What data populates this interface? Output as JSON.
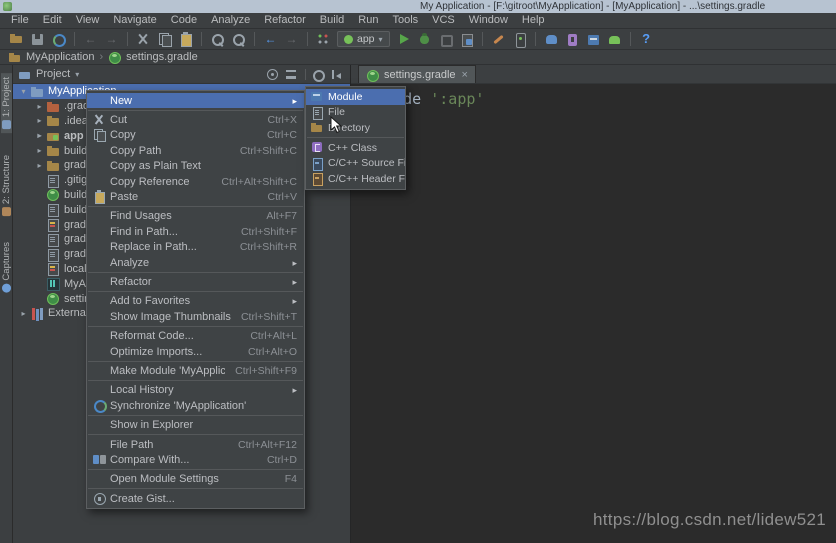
{
  "window": {
    "title": "My Application - [F:\\gitroot\\MyApplication] - [MyApplication] - ...\\settings.gradle"
  },
  "menu_bar": {
    "items": [
      "File",
      "Edit",
      "View",
      "Navigate",
      "Code",
      "Analyze",
      "Refactor",
      "Build",
      "Run",
      "Tools",
      "VCS",
      "Window",
      "Help"
    ]
  },
  "toolbar": {
    "app_selector_label": "app",
    "icons": [
      "open-icon",
      "save-icon",
      "sync-icon",
      "undo-icon",
      "redo-icon",
      "cut-icon",
      "copy-icon",
      "paste-icon",
      "find-icon",
      "search-everywhere-icon",
      "back-icon",
      "forward-icon",
      "run-config-icon",
      "app-selector",
      "run-icon",
      "debug-icon",
      "coverage-icon",
      "attach-debugger-icon",
      "sdk-manager-icon",
      "avd-manager-icon",
      "gradle-sync-icon",
      "device-explorer-icon",
      "build-icon",
      "android-icon",
      "help-icon"
    ]
  },
  "breadcrumb": {
    "project": "MyApplication",
    "file": "settings.gradle"
  },
  "left_stripe": {
    "items": [
      "1: Project",
      "2: Structure",
      "Captures"
    ]
  },
  "project_panel": {
    "header": "Project",
    "tree": [
      {
        "label": "MyApplication",
        "icon": "project-folder",
        "state": "expanded",
        "selected": true
      },
      {
        "label": ".gradle",
        "icon": "folder",
        "state": "collapsed"
      },
      {
        "label": ".idea",
        "icon": "folder",
        "state": "collapsed"
      },
      {
        "label": "app",
        "icon": "module-folder",
        "state": "collapsed"
      },
      {
        "label": "build",
        "icon": "folder",
        "state": "collapsed"
      },
      {
        "label": "gradle",
        "icon": "folder",
        "state": "collapsed"
      },
      {
        "label": ".gitignore",
        "icon": "file"
      },
      {
        "label": "build.gradle",
        "icon": "gradle-file"
      },
      {
        "label": "build.gradle",
        "icon": "file"
      },
      {
        "label": "gradle.properties",
        "icon": "properties-file"
      },
      {
        "label": "gradlew",
        "icon": "file"
      },
      {
        "label": "gradlew.bat",
        "icon": "file"
      },
      {
        "label": "local.properties",
        "icon": "properties-file"
      },
      {
        "label": "MyApplication.iml",
        "icon": "android-studio-file"
      },
      {
        "label": "settings.gradle",
        "icon": "gradle-file"
      },
      {
        "label": "External Libraries",
        "icon": "libraries",
        "state": "collapsed"
      }
    ]
  },
  "editor": {
    "tab_label": "settings.gradle",
    "code": {
      "method": "include ",
      "argument": "':app'"
    }
  },
  "context_menu": {
    "items": [
      {
        "label": "New",
        "submenu": true,
        "highlighted": true
      },
      {
        "label": "Cut",
        "shortcut": "Ctrl+X",
        "icon": "cut-icon"
      },
      {
        "label": "Copy",
        "shortcut": "Ctrl+C",
        "icon": "copy-icon"
      },
      {
        "label": "Copy Path",
        "shortcut": "Ctrl+Shift+C"
      },
      {
        "label": "Copy as Plain Text"
      },
      {
        "label": "Copy Reference",
        "shortcut": "Ctrl+Alt+Shift+C"
      },
      {
        "label": "Paste",
        "shortcut": "Ctrl+V",
        "icon": "paste-icon"
      },
      {
        "label": "Find Usages",
        "shortcut": "Alt+F7"
      },
      {
        "label": "Find in Path...",
        "shortcut": "Ctrl+Shift+F"
      },
      {
        "label": "Replace in Path...",
        "shortcut": "Ctrl+Shift+R"
      },
      {
        "label": "Analyze",
        "submenu": true
      },
      {
        "label": "Refactor",
        "submenu": true
      },
      {
        "label": "Add to Favorites",
        "submenu": true
      },
      {
        "label": "Show Image Thumbnails",
        "shortcut": "Ctrl+Shift+T"
      },
      {
        "label": "Reformat Code...",
        "shortcut": "Ctrl+Alt+L"
      },
      {
        "label": "Optimize Imports...",
        "shortcut": "Ctrl+Alt+O"
      },
      {
        "label": "Make Module 'MyApplication'",
        "shortcut": "Ctrl+Shift+F9"
      },
      {
        "label": "Local History",
        "submenu": true
      },
      {
        "label": "Synchronize 'MyApplication'",
        "icon": "sync-icon"
      },
      {
        "label": "Show in Explorer"
      },
      {
        "label": "File Path",
        "shortcut": "Ctrl+Alt+F12"
      },
      {
        "label": "Compare With...",
        "shortcut": "Ctrl+D",
        "icon": "compare-icon"
      },
      {
        "label": "Open Module Settings",
        "shortcut": "F4"
      },
      {
        "label": "Create Gist...",
        "icon": "gist-icon"
      }
    ]
  },
  "new_submenu": {
    "items": [
      {
        "label": "Module",
        "icon": "module-icon",
        "highlighted": true
      },
      {
        "label": "File",
        "icon": "file-icon"
      },
      {
        "label": "Directory",
        "icon": "directory-icon"
      },
      {
        "label": "C++ Class",
        "icon": "cpp-class-icon"
      },
      {
        "label": "C/C++ Source File",
        "icon": "cpp-source-icon"
      },
      {
        "label": "C/C++ Header File",
        "icon": "cpp-header-icon"
      }
    ]
  },
  "watermark": {
    "text": "https://blog.csdn.net/lidew521"
  },
  "colors": {
    "selection_blue": "#4b6eaf",
    "panel_bg": "#3c3f41",
    "editor_bg": "#2b2b2b",
    "titlebar": "#b7c3d1",
    "string_green": "#6a8759",
    "code_fg": "#a9b7c6",
    "run_green": "#57a64a"
  }
}
